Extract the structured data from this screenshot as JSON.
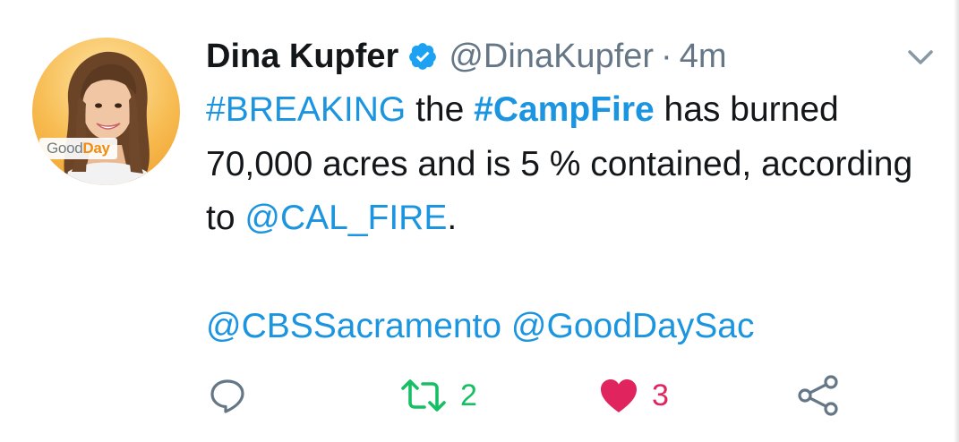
{
  "tweet": {
    "author": {
      "display_name": "Dina Kupfer",
      "handle": "@DinaKupfer",
      "separator": "·",
      "time": "4m",
      "verified": true,
      "avatar_logo": {
        "good": "Good",
        "day": "Day"
      }
    },
    "body": {
      "hashtag_breaking": "#BREAKING",
      "text_1": " the ",
      "hashtag_campfire": "#CampFire",
      "text_2": " has burned 70,000 acres and is 5 % contained, according to ",
      "mention_calfire": "@CAL_FIRE",
      "text_3": ".",
      "mention_cbs": "@CBSSacramento",
      "mention_goodday": "@GoodDaySac"
    },
    "actions": {
      "reply_icon": "reply-icon",
      "retweet_icon": "retweet-icon",
      "retweet_count": "2",
      "like_icon": "heart-icon",
      "like_count": "3",
      "share_icon": "share-icon"
    }
  },
  "colors": {
    "link": "#1b95e0",
    "retweet": "#17bf63",
    "like": "#e0245e",
    "muted": "#657786",
    "text": "#14171a"
  }
}
